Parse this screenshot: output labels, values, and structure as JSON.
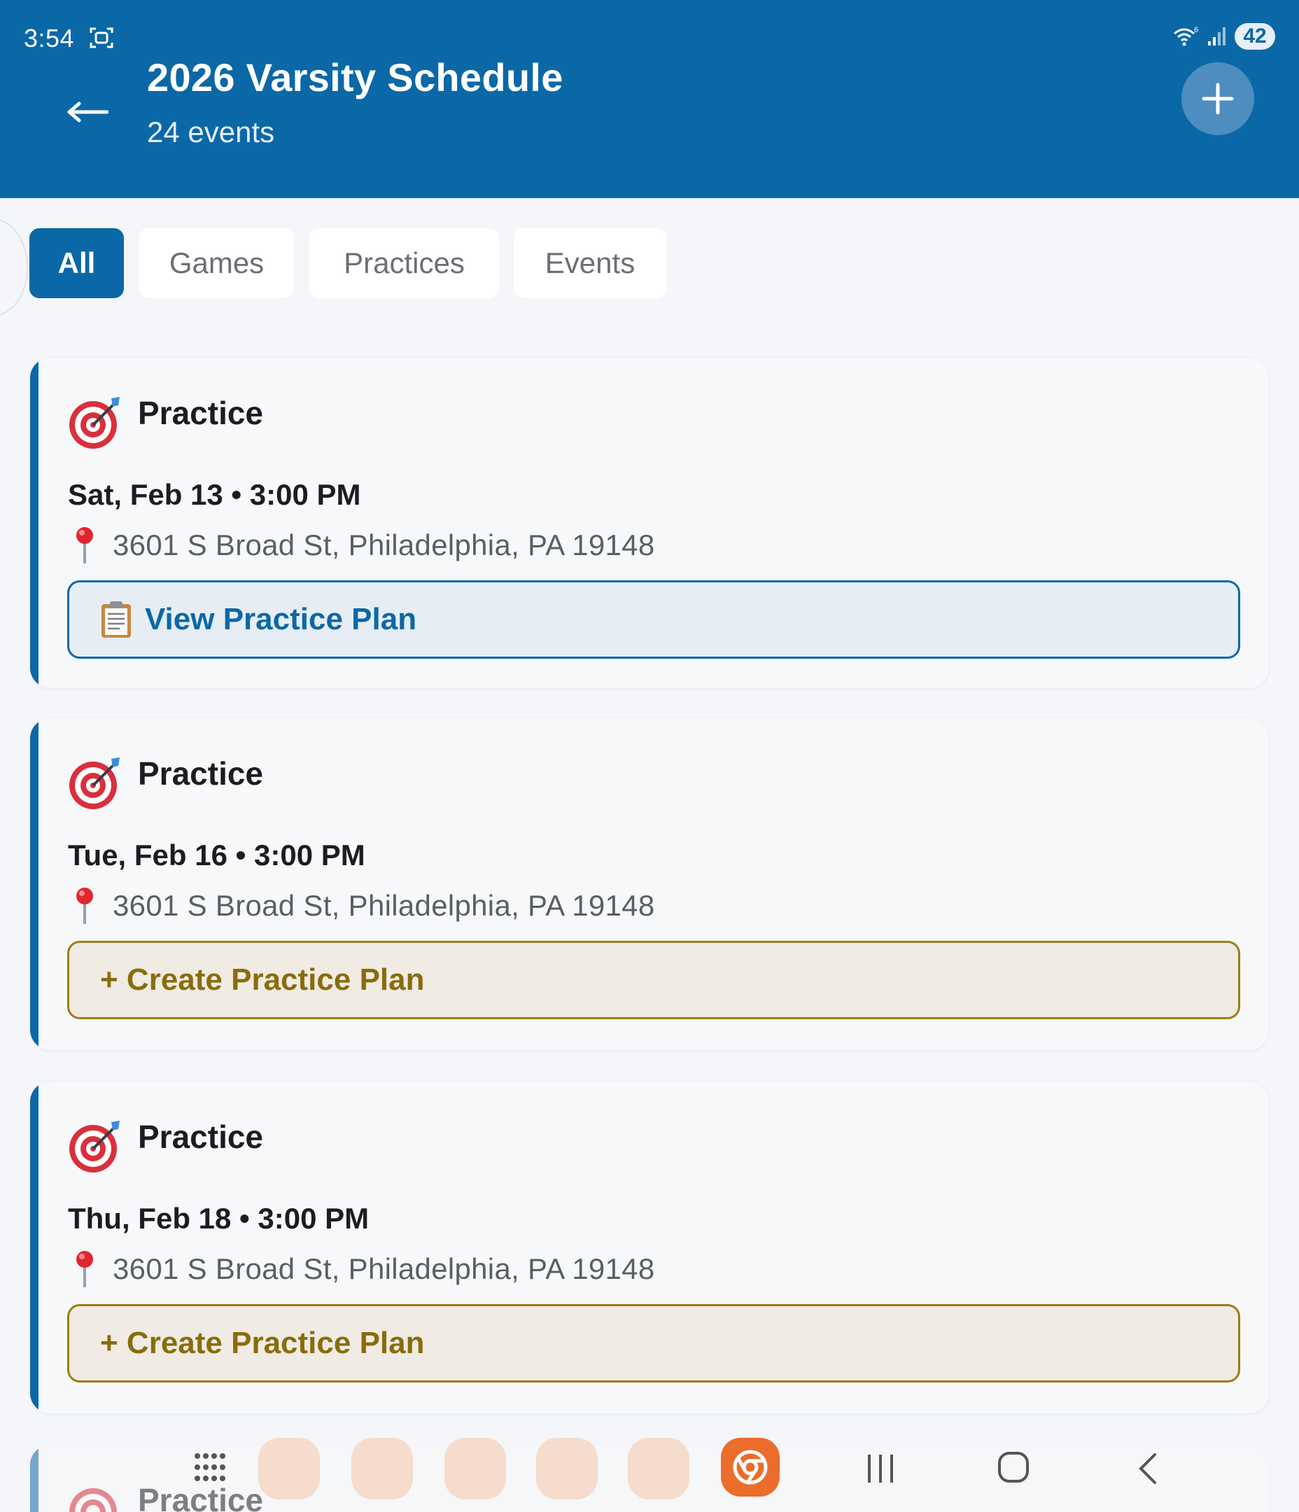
{
  "status_bar": {
    "time": "3:54",
    "battery": "42"
  },
  "header": {
    "title": "2026 Varsity Schedule",
    "subtitle": "24 events"
  },
  "filters": [
    {
      "label": "All",
      "active": true
    },
    {
      "label": "Games",
      "active": false
    },
    {
      "label": "Practices",
      "active": false
    },
    {
      "label": "Events",
      "active": false
    }
  ],
  "events": [
    {
      "type": "Practice",
      "date": "Sat, Feb 13 • 3:00 PM",
      "location": "3601 S Broad St, Philadelphia, PA 19148",
      "action": "View Practice Plan",
      "action_kind": "view"
    },
    {
      "type": "Practice",
      "date": "Tue, Feb 16 • 3:00 PM",
      "location": "3601 S Broad St, Philadelphia, PA 19148",
      "action": "+ Create Practice Plan",
      "action_kind": "create"
    },
    {
      "type": "Practice",
      "date": "Thu, Feb 18 • 3:00 PM",
      "location": "3601 S Broad St, Philadelphia, PA 19148",
      "action": "+ Create Practice Plan",
      "action_kind": "create"
    },
    {
      "type": "Practice"
    }
  ],
  "icons": {
    "event_type": "target-dart-icon",
    "location": "map-pin-icon",
    "view_plan": "clipboard-icon",
    "back": "arrow-left-icon",
    "add": "plus-icon"
  },
  "colors": {
    "primary": "#0b68a6",
    "view_button_bg": "#e6edf4",
    "create_button_border": "#9a7d16",
    "create_button_text": "#8a6c0c",
    "create_button_bg": "#f0ece4"
  }
}
